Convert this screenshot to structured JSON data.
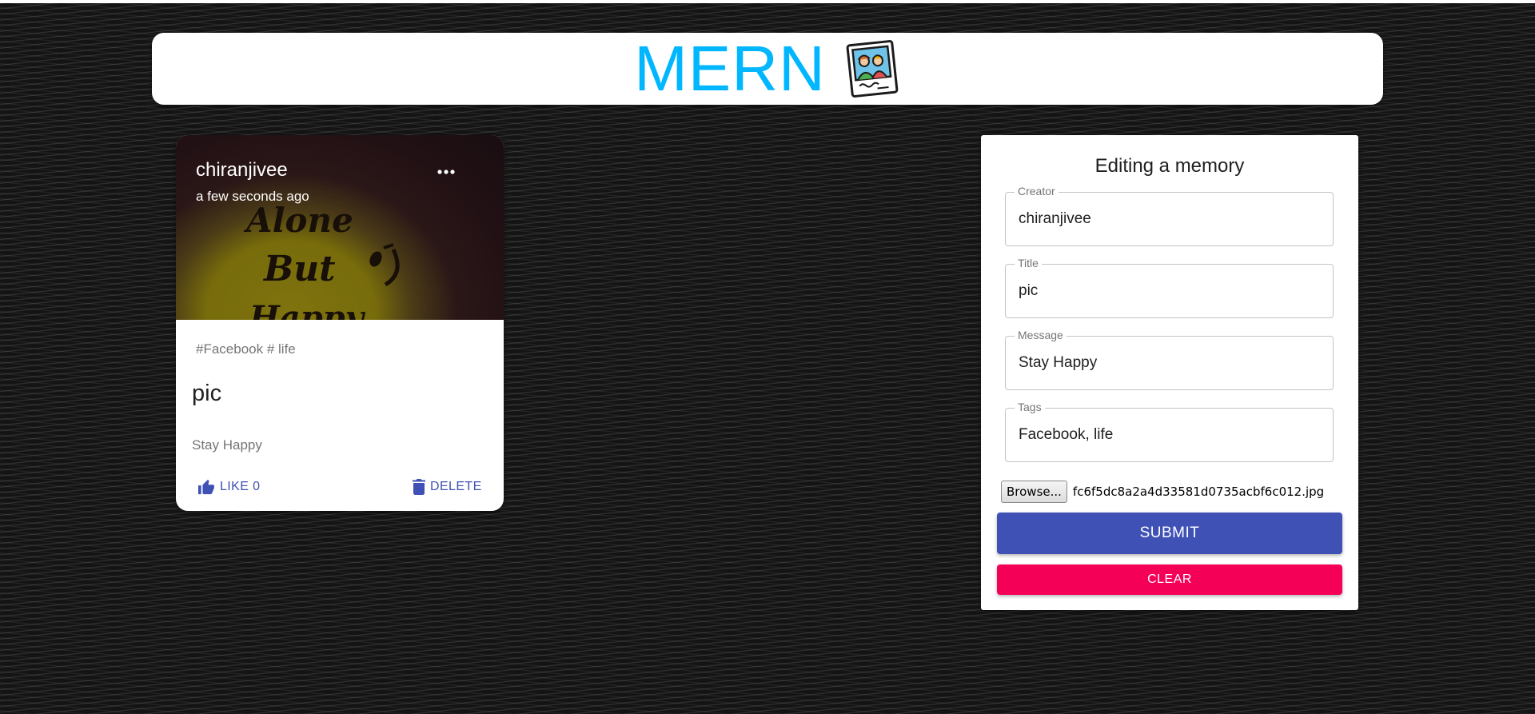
{
  "app": {
    "brand": "MERN",
    "logo_icon": "memories-photo-icon",
    "colors": {
      "brand": "#00b7ff",
      "primary": "#3f51b5",
      "secondary": "#f50057"
    }
  },
  "post": {
    "creator": "chiranjivee",
    "time": "a few seconds ago",
    "image_text": [
      "Alone",
      "But",
      "Happy"
    ],
    "tags": "#Facebook # life",
    "title": "pic",
    "message": "Stay Happy",
    "like_label": "LIKE 0",
    "delete_label": "DELETE",
    "more_icon": "more-horiz-icon",
    "like_icon": "thumb-up-icon",
    "delete_icon": "trash-icon"
  },
  "form": {
    "heading": "Editing a memory",
    "fields": [
      {
        "label": "Creator",
        "value": "chiranjivee"
      },
      {
        "label": "Title",
        "value": "pic"
      },
      {
        "label": "Message",
        "value": "Stay Happy"
      },
      {
        "label": "Tags",
        "value": "Facebook, life"
      }
    ],
    "browse_label": "Browse...",
    "file_name": "fc6f5dc8a2a4d33581d0735acbf6c012.jpg",
    "submit_label": "SUBMIT",
    "clear_label": "CLEAR"
  }
}
